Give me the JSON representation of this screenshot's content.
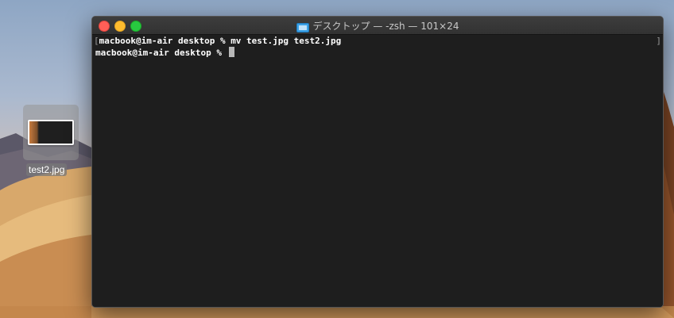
{
  "window": {
    "title": "デスクトップ — -zsh — 101×24",
    "folder_icon": "folder-icon"
  },
  "desktop": {
    "file_name": "test2.jpg",
    "file_icon": "jpg-thumbnail-icon"
  },
  "terminal": {
    "lines": [
      "macbook@im-air desktop % mv test.jpg test2.jpg",
      "macbook@im-air desktop % "
    ],
    "line_prefix_bracket": "[",
    "right_bracket": "]"
  },
  "colors": {
    "close": "#ff5f57",
    "minimize": "#febc2e",
    "zoom": "#28c840",
    "terminal_bg": "#1e1e1e",
    "folder_accent": "#3ba1e6"
  }
}
